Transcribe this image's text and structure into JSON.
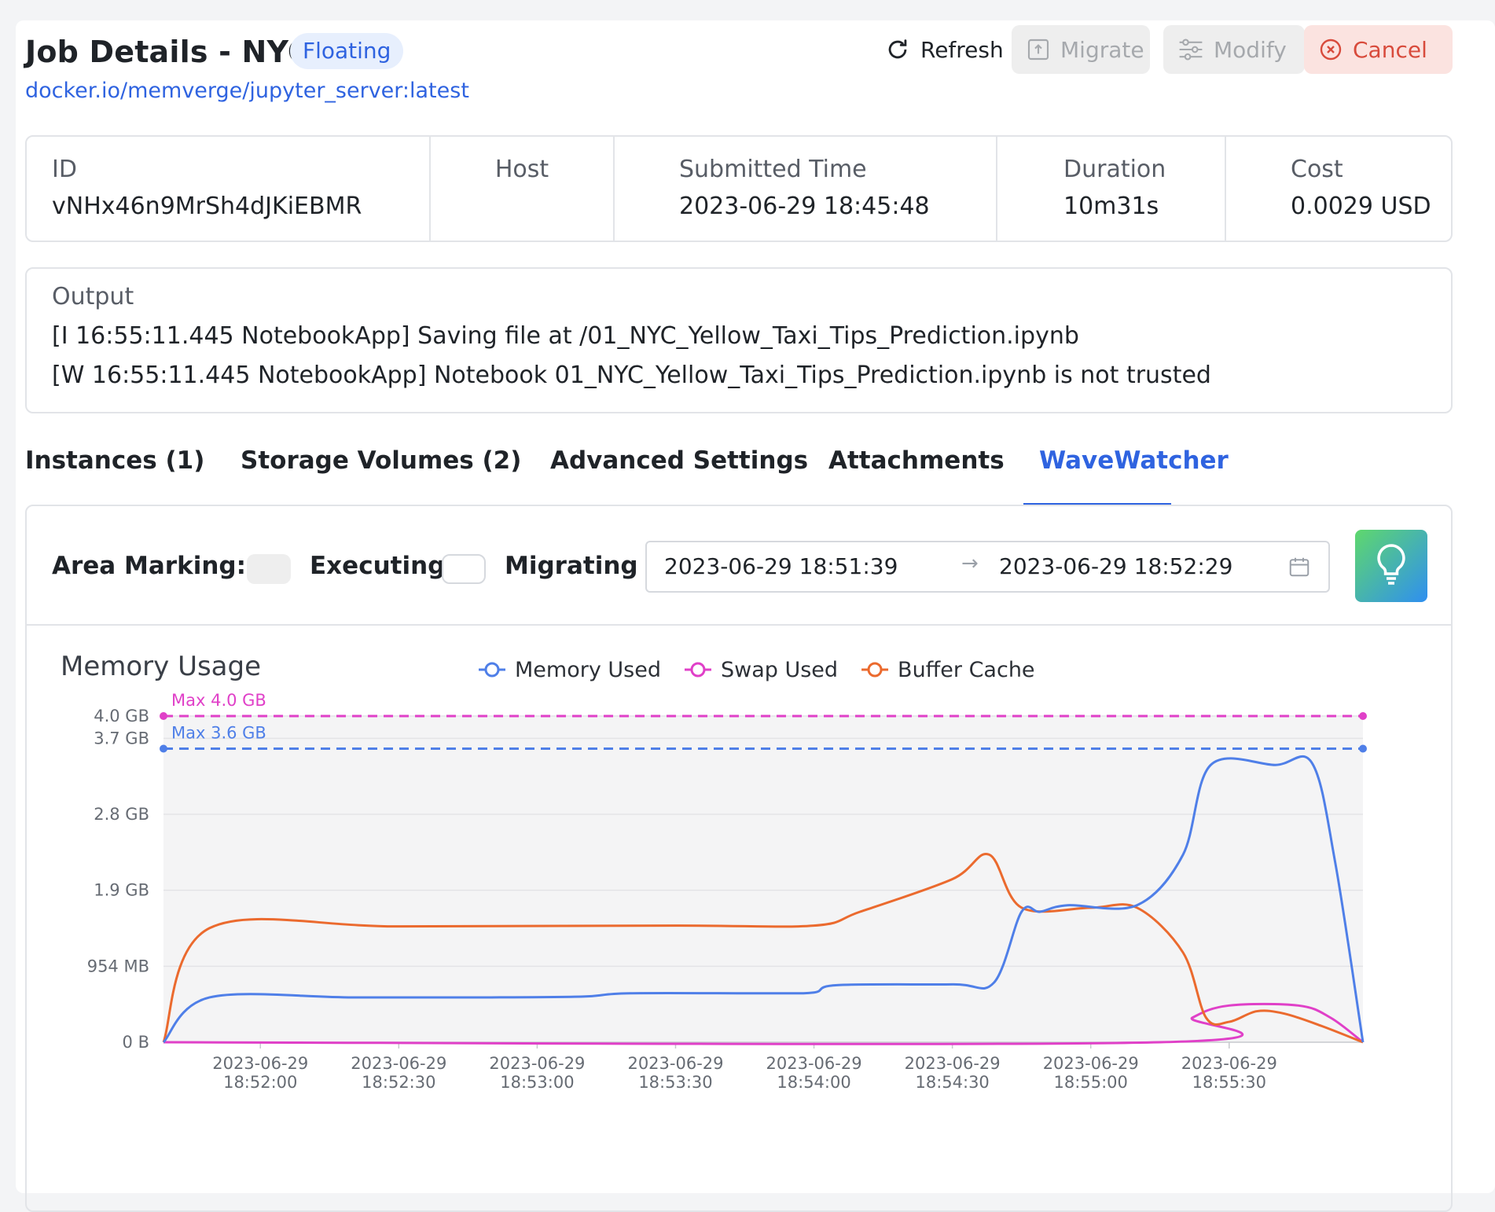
{
  "header": {
    "title": "Job Details - NYC",
    "badge": "Floating",
    "image": "docker.io/memverge/jupyter_server:latest"
  },
  "actions": {
    "refresh": "Refresh",
    "migrate": "Migrate",
    "modify": "Modify",
    "cancel": "Cancel"
  },
  "info": {
    "id_label": "ID",
    "id_value": "vNHx46n9MrSh4dJKiEBMR",
    "host_label": "Host",
    "host_value": "",
    "submitted_label": "Submitted Time",
    "submitted_value": "2023-06-29 18:45:48",
    "duration_label": "Duration",
    "duration_value": "10m31s",
    "cost_label": "Cost",
    "cost_value": "0.0029 USD"
  },
  "output": {
    "label": "Output",
    "lines": [
      "[I 16:55:11.445 NotebookApp] Saving file at /01_NYC_Yellow_Taxi_Tips_Prediction.ipynb",
      "[W 16:55:11.445 NotebookApp] Notebook 01_NYC_Yellow_Taxi_Tips_Prediction.ipynb is not trusted"
    ]
  },
  "tabs": [
    "Instances (1)",
    "Storage Volumes (2)",
    "Advanced Settings",
    "Attachments",
    "WaveWatcher"
  ],
  "active_tab": "WaveWatcher",
  "wavewatcher": {
    "area_marking_label": "Area Marking:",
    "executing_label": "Executing",
    "migrating_label": "Migrating",
    "range_start": "2023-06-29 18:51:39",
    "range_arrow": "→",
    "range_end": "2023-06-29 18:52:29"
  },
  "chart_data": {
    "type": "line",
    "title": "Memory Usage",
    "y_ticks": [
      "0 B",
      "954 MB",
      "1.9 GB",
      "2.8 GB",
      "3.7 GB",
      "4.0 GB"
    ],
    "y_tick_values": [
      0,
      0.9316,
      1.8633,
      2.7949,
      3.7266,
      4.0
    ],
    "ylim": [
      0,
      4.0
    ],
    "xlim": [
      "2023-06-29 18:51:39",
      "2023-06-29 18:55:59"
    ],
    "x_ticks": [
      {
        "date": "2023-06-29",
        "time": "18:52:00",
        "t": "2023-06-29 18:52:00"
      },
      {
        "date": "2023-06-29",
        "time": "18:52:30",
        "t": "2023-06-29 18:52:30"
      },
      {
        "date": "2023-06-29",
        "time": "18:53:00",
        "t": "2023-06-29 18:53:00"
      },
      {
        "date": "2023-06-29",
        "time": "18:53:30",
        "t": "2023-06-29 18:53:30"
      },
      {
        "date": "2023-06-29",
        "time": "18:54:00",
        "t": "2023-06-29 18:54:00"
      },
      {
        "date": "2023-06-29",
        "time": "18:54:30",
        "t": "2023-06-29 18:54:30"
      },
      {
        "date": "2023-06-29",
        "time": "18:55:00",
        "t": "2023-06-29 18:55:00"
      },
      {
        "date": "2023-06-29",
        "time": "18:55:30",
        "t": "2023-06-29 18:55:30"
      }
    ],
    "thresholds": [
      {
        "label": "Max 4.0 GB",
        "value": 4.0,
        "color": "#e040c8"
      },
      {
        "label": "Max 3.6 GB",
        "value": 3.6,
        "color": "#4f7fe8"
      }
    ],
    "legend_position": "top-center",
    "series": [
      {
        "name": "Memory Used",
        "color": "#4f7fe8",
        "points": [
          [
            "2023-06-29 18:51:39",
            0
          ],
          [
            "2023-06-29 18:51:49",
            0.55
          ],
          [
            "2023-06-29 18:52:20",
            0.55
          ],
          [
            "2023-06-29 18:52:50",
            0.55
          ],
          [
            "2023-06-29 18:53:10",
            0.56
          ],
          [
            "2023-06-29 18:53:20",
            0.6
          ],
          [
            "2023-06-29 18:53:50",
            0.6
          ],
          [
            "2023-06-29 18:54:00",
            0.61
          ],
          [
            "2023-06-29 18:54:05",
            0.7
          ],
          [
            "2023-06-29 18:54:30",
            0.71
          ],
          [
            "2023-06-29 18:54:39",
            0.73
          ],
          [
            "2023-06-29 18:54:45",
            1.6
          ],
          [
            "2023-06-29 18:54:49",
            1.6
          ],
          [
            "2023-06-29 18:54:55",
            1.68
          ],
          [
            "2023-06-29 18:55:10",
            1.68
          ],
          [
            "2023-06-29 18:55:20",
            2.3
          ],
          [
            "2023-06-29 18:55:26",
            3.4
          ],
          [
            "2023-06-29 18:55:40",
            3.4
          ],
          [
            "2023-06-29 18:55:48",
            3.42
          ],
          [
            "2023-06-29 18:55:53",
            2.2
          ],
          [
            "2023-06-29 18:55:59",
            0
          ]
        ]
      },
      {
        "name": "Swap Used",
        "color": "#e040c8",
        "points": [
          [
            "2023-06-29 18:51:39",
            0
          ],
          [
            "2023-06-29 18:55:15",
            0
          ],
          [
            "2023-06-29 18:55:22",
            0.3
          ],
          [
            "2023-06-29 18:55:30",
            0.45
          ],
          [
            "2023-06-29 18:55:45",
            0.45
          ],
          [
            "2023-06-29 18:55:52",
            0.3
          ],
          [
            "2023-06-29 18:55:59",
            0
          ]
        ]
      },
      {
        "name": "Buffer Cache",
        "color": "#eb6a2e",
        "points": [
          [
            "2023-06-29 18:51:39",
            0
          ],
          [
            "2023-06-29 18:51:49",
            1.4
          ],
          [
            "2023-06-29 18:52:30",
            1.42
          ],
          [
            "2023-06-29 18:53:30",
            1.43
          ],
          [
            "2023-06-29 18:54:00",
            1.43
          ],
          [
            "2023-06-29 18:54:10",
            1.6
          ],
          [
            "2023-06-29 18:54:30",
            2.0
          ],
          [
            "2023-06-29 18:54:38",
            2.3
          ],
          [
            "2023-06-29 18:54:45",
            1.65
          ],
          [
            "2023-06-29 18:55:00",
            1.65
          ],
          [
            "2023-06-29 18:55:10",
            1.65
          ],
          [
            "2023-06-29 18:55:20",
            1.1
          ],
          [
            "2023-06-29 18:55:25",
            0.3
          ],
          [
            "2023-06-29 18:55:30",
            0.25
          ],
          [
            "2023-06-29 18:55:36",
            0.38
          ],
          [
            "2023-06-29 18:55:42",
            0.35
          ],
          [
            "2023-06-29 18:55:50",
            0.2
          ],
          [
            "2023-06-29 18:55:59",
            0
          ]
        ]
      }
    ]
  }
}
